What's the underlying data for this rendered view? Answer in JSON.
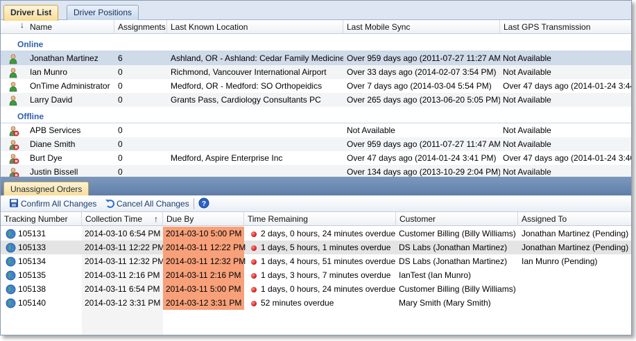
{
  "tabs": [
    "Driver List",
    "Driver Positions"
  ],
  "driver_columns": [
    "Name",
    "Assignments",
    "Last Known Location",
    "Last Mobile Sync",
    "Last GPS Transmission"
  ],
  "groups": {
    "online": "Online",
    "offline": "Offline"
  },
  "online_drivers": [
    {
      "name": "Jonathan Martinez",
      "assignments": "6",
      "location": "Ashland, OR - Ashland: Cedar Family Medicine",
      "sync": "Over 959 days ago (2011-07-27 11:27 AM)",
      "gps": "Not Available"
    },
    {
      "name": "Ian Munro",
      "assignments": "0",
      "location": "Richmond, Vancouver International Airport",
      "sync": "Over 33 days ago (2014-02-07 3:54 PM)",
      "gps": "Not Available"
    },
    {
      "name": "OnTime Administrator",
      "assignments": "0",
      "location": "Medford, OR - Medford: SO Orthopeidics",
      "sync": "Over 7 days ago (2014-03-04 5:54 PM)",
      "gps": "Over 47 days ago (2014-01-24 3:44"
    },
    {
      "name": "Larry David",
      "assignments": "0",
      "location": "Grants Pass, Cardiology Consultants PC",
      "sync": "Over 265 days ago (2013-06-20 5:05 PM)",
      "gps": "Not Available"
    }
  ],
  "offline_drivers": [
    {
      "name": "APB Services",
      "assignments": "0",
      "location": "",
      "sync": "Not Available",
      "gps": "Not Available"
    },
    {
      "name": "Diane Smith",
      "assignments": "0",
      "location": "",
      "sync": "Over 959 days ago (2011-07-27 11:47 AM)",
      "gps": "Not Available"
    },
    {
      "name": "Burt Dye",
      "assignments": "0",
      "location": "Medford, Aspire Enterprise Inc",
      "sync": "Over 47 days ago (2014-01-24 3:41 PM)",
      "gps": "Over 47 days ago (2014-01-24 3:40"
    },
    {
      "name": "Justin Bissell",
      "assignments": "0",
      "location": "",
      "sync": "Over 134 days ago (2013-10-29 2:04 PM)",
      "gps": "Not Available"
    }
  ],
  "orders_tab": "Unassigned Orders",
  "toolbar": {
    "confirm": "Confirm All Changes",
    "cancel": "Cancel All Changes"
  },
  "order_columns": [
    "Tracking Number",
    "Collection Time",
    "Due By",
    "Time Remaining",
    "Customer",
    "Assigned To"
  ],
  "orders": [
    {
      "tracking": "105131",
      "collection": "2014-03-10 6:54 PM",
      "due": "2014-03-10 5:00 PM",
      "remaining": "2 days, 0 hours, 24 minutes overdue",
      "customer": "Customer Billing (Billy Williams)",
      "assigned": "Jonathan Martinez (Pending)"
    },
    {
      "tracking": "105133",
      "collection": "2014-03-11 12:22 PM",
      "due": "2014-03-11 12:22 PM",
      "remaining": "1 days, 5 hours, 1 minutes overdue",
      "customer": "DS Labs (Jonathan Martinez)",
      "assigned": "Jonathan Martinez (Pending)"
    },
    {
      "tracking": "105134",
      "collection": "2014-03-11 12:32 PM",
      "due": "2014-03-11 12:32 PM",
      "remaining": "1 days, 4 hours, 51 minutes overdue",
      "customer": "DS Labs (Jonathan Martinez)",
      "assigned": "Ian  Munro (Pending)"
    },
    {
      "tracking": "105135",
      "collection": "2014-03-11 2:16 PM",
      "due": "2014-03-11 2:16 PM",
      "remaining": "1 days, 3 hours, 7 minutes overdue",
      "customer": "IanTest (Ian Munro)",
      "assigned": ""
    },
    {
      "tracking": "105138",
      "collection": "2014-03-11 6:54 PM",
      "due": "2014-03-11 5:00 PM",
      "remaining": "1 days, 0 hours, 24 minutes overdue",
      "customer": "Customer Billing (Billy Williams)",
      "assigned": ""
    },
    {
      "tracking": "105140",
      "collection": "2014-03-12 3:31 PM",
      "due": "2014-03-12 3:31 PM",
      "remaining": "52 minutes overdue",
      "customer": "Mary Smith (Mary Smith)",
      "assigned": ""
    }
  ],
  "colors": {
    "due_highlight": "#f7a07a",
    "group_label": "#2e61a8",
    "overdue_dot": "#d01515"
  }
}
